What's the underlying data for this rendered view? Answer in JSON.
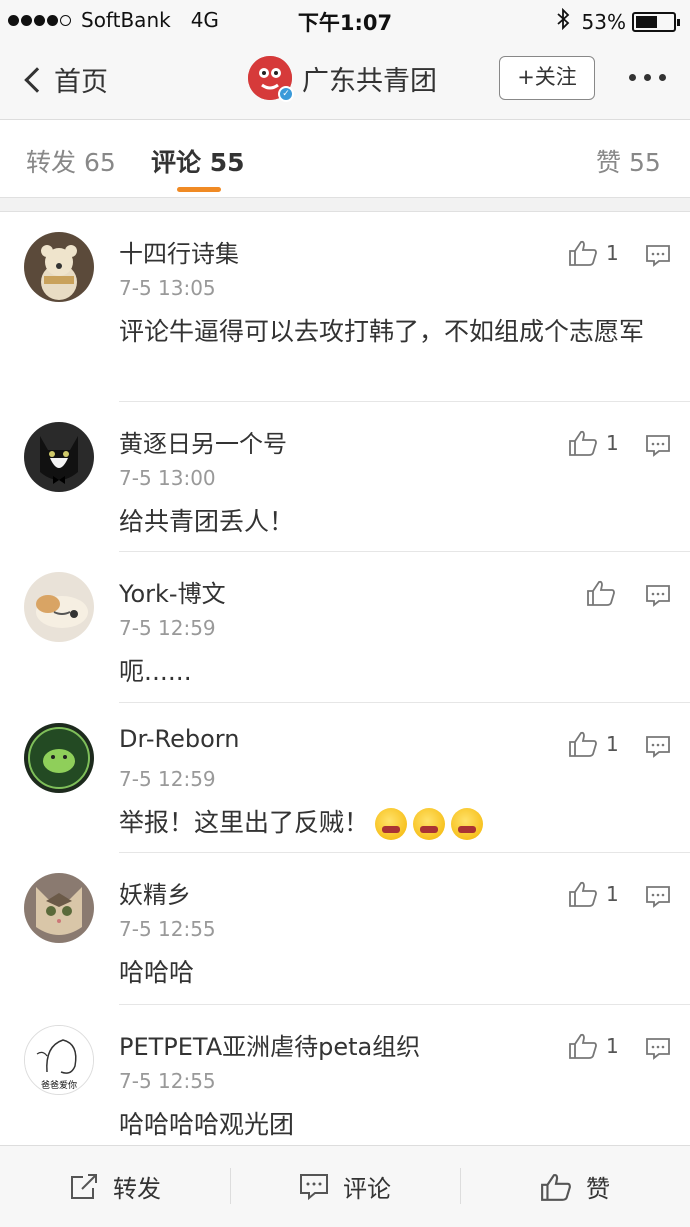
{
  "status_bar": {
    "carrier": "SoftBank",
    "network": "4G",
    "time": "下午1:07",
    "battery": "53%",
    "battery_level": 0.53
  },
  "nav": {
    "back_label": "首页",
    "title": "广东共青团",
    "follow_label": "+关注"
  },
  "tabs": {
    "repost": "转发 65",
    "comment": "评论 55",
    "like": "赞 55"
  },
  "comments": [
    {
      "name": "十四行诗集",
      "time": "7-5 13:05",
      "text": "评论牛逼得可以去攻打韩了，不如组成个志愿军",
      "likes": "1",
      "avatar": "teddy-bear"
    },
    {
      "name": "黄逐日另一个号",
      "time": "7-5 13:00",
      "text": "给共青团丢人！",
      "likes": "1",
      "avatar": "cat-bowtie"
    },
    {
      "name": "York-博文",
      "time": "7-5 12:59",
      "text": "呃......",
      "likes": "",
      "avatar": "sleeping-dog"
    },
    {
      "name": "Dr-Reborn",
      "time": "7-5 12:59",
      "text": "举报！这里出了反贼！",
      "likes": "1",
      "avatar": "green-badge",
      "emoji_count": 3,
      "emoji_name": "angry-face-emoji"
    },
    {
      "name": "妖精乡",
      "time": "7-5 12:55",
      "text": "哈哈哈",
      "likes": "1",
      "avatar": "tabby-cat"
    },
    {
      "name": "PETPETA亚洲虐待peta组织",
      "time": "7-5 12:55",
      "text": "哈哈哈哈观光团",
      "likes": "1",
      "avatar": "sketch"
    }
  ],
  "avatar_captions": {
    "sketch": "爸爸爱你"
  },
  "bottom_bar": {
    "repost": "转发",
    "comment": "评论",
    "like": "赞"
  },
  "colors": {
    "accent": "#f08a24",
    "verified": "#3a9ad9"
  }
}
